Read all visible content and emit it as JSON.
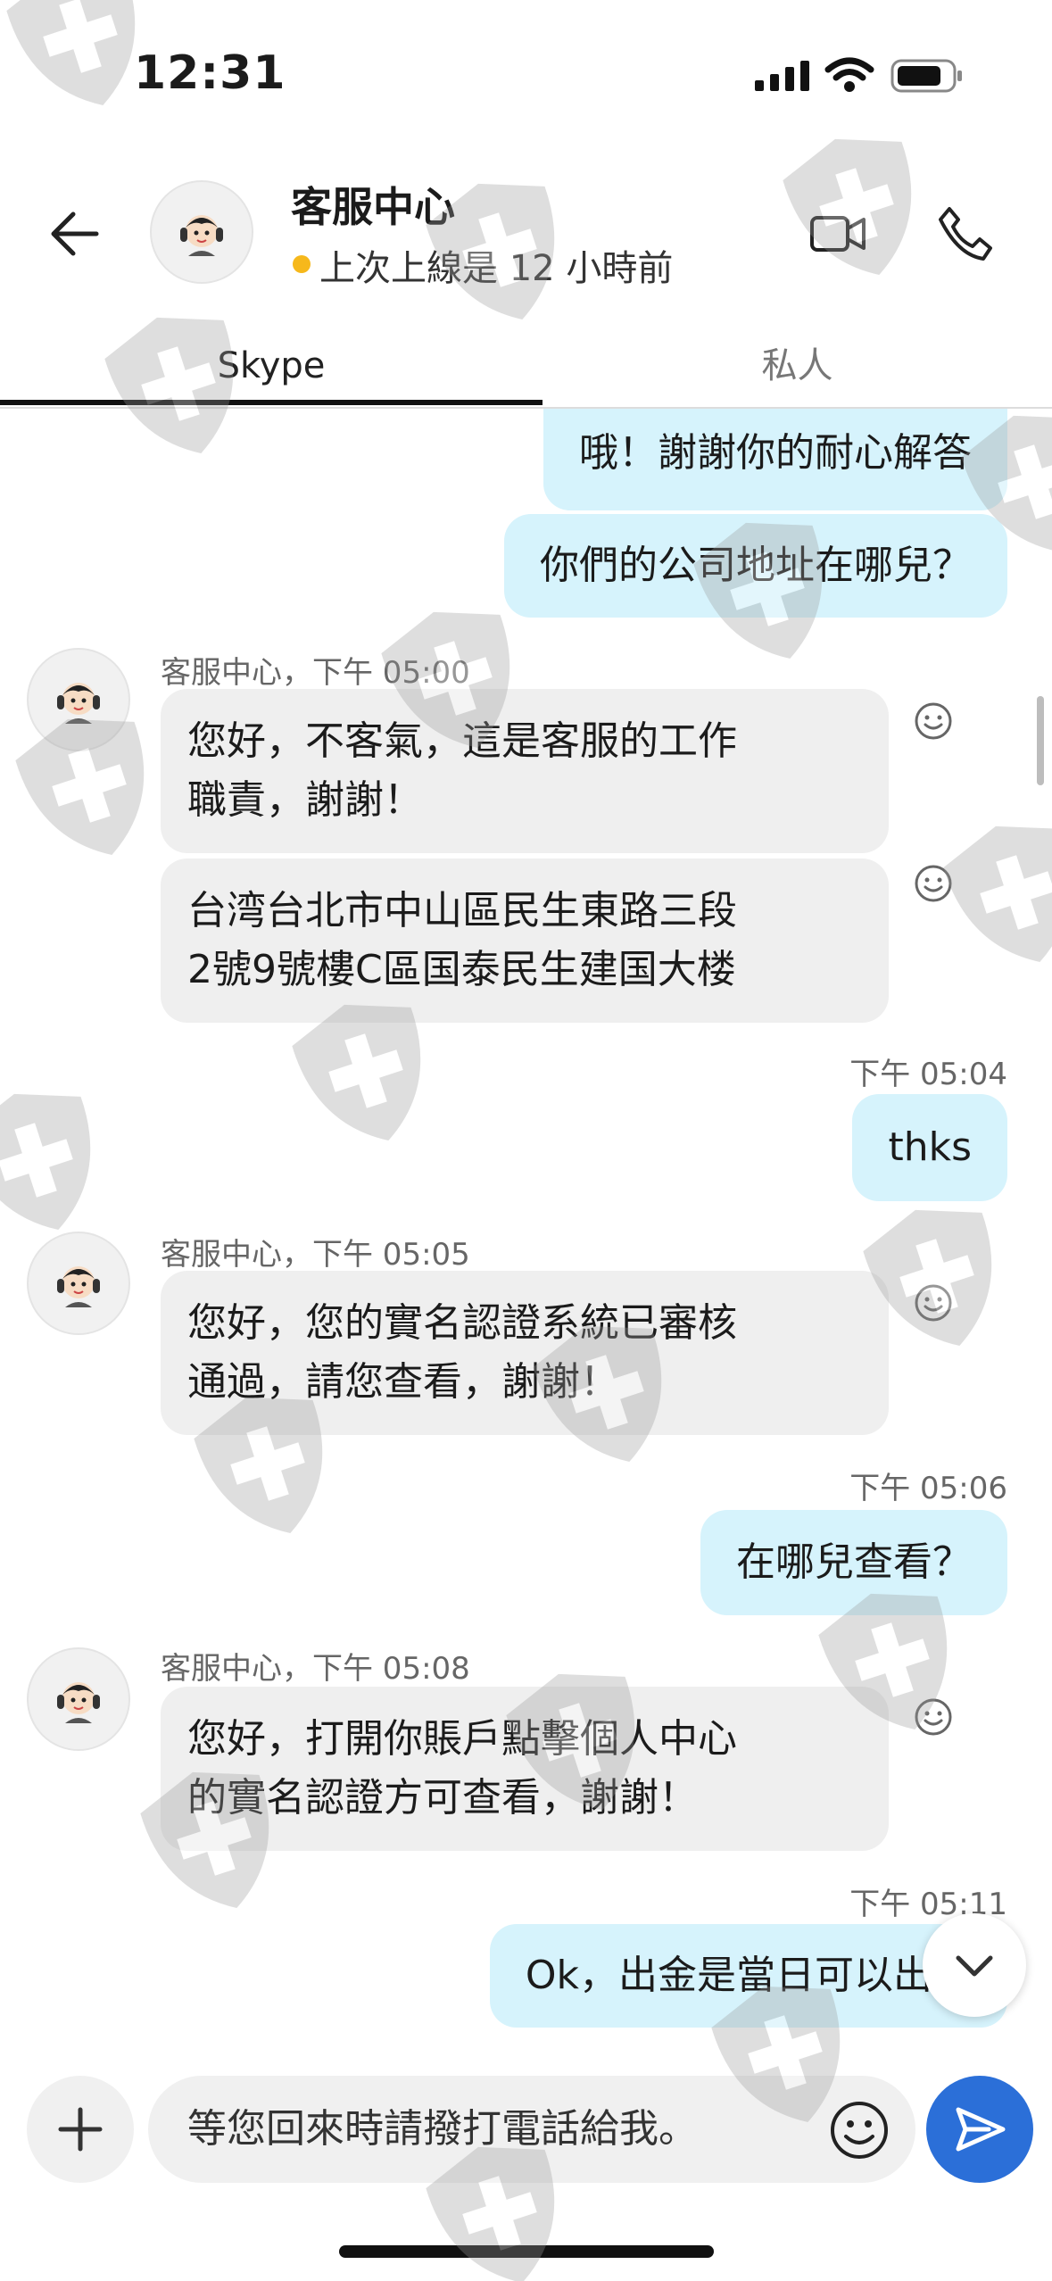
{
  "status_bar": {
    "time": "12:31"
  },
  "header": {
    "title": "客服中心",
    "status": "上次上線是 12 小時前",
    "presence_color": "#f6b81b"
  },
  "tabs": [
    {
      "label": "Skype",
      "active": true
    },
    {
      "label": "私人",
      "active": false
    }
  ],
  "messages": {
    "out1": {
      "text": "哦！謝謝你的耐心解答"
    },
    "out2": {
      "text": "你們的公司地址在哪兒？"
    },
    "in1": {
      "sender": "客服中心",
      "time": "下午 05:00",
      "line1": "您好，不客氣，這是客服的工作",
      "line2": "職責，謝謝！"
    },
    "in2": {
      "line1": "台湾台北市中山區民生東路三段",
      "line2": "2號9號樓C區国泰民生建国大楼"
    },
    "out3": {
      "time": "下午 05:04",
      "text": "thks"
    },
    "in3": {
      "sender": "客服中心",
      "time": "下午 05:05",
      "line1": "您好，您的實名認證系統已審核",
      "line2": "通過，請您查看，謝謝！"
    },
    "out4": {
      "time": "下午 05:06",
      "text": "在哪兒查看？"
    },
    "in4": {
      "sender": "客服中心",
      "time": "下午 05:08",
      "line1": "您好，打開你賬戶點擊個人中心",
      "line2": "的實名認證方可查看，謝謝！"
    },
    "out5": {
      "time": "下午 05:11",
      "text": "Ok，出金是當日可以出嗎"
    }
  },
  "composer": {
    "value": "等您回來時請撥打電話給我。"
  },
  "colors": {
    "outgoing_bubble": "#d6f3fc",
    "incoming_bubble": "#efefef",
    "send_button": "#2b6fd8"
  },
  "icons": [
    "back-arrow-icon",
    "video-call-icon",
    "phone-icon",
    "smiley-react-icon",
    "plus-icon",
    "emoji-icon",
    "send-icon",
    "chevron-down-icon",
    "shield-cross-watermark-icon"
  ]
}
